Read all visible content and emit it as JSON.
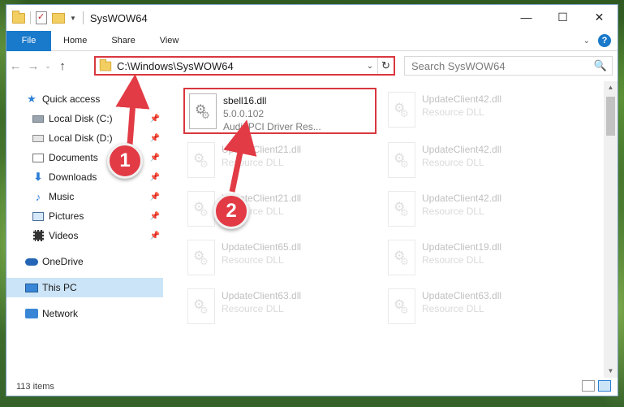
{
  "window": {
    "title": "SysWOW64"
  },
  "winctl": {
    "minimize": "—",
    "maximize": "☐",
    "close": "✕"
  },
  "ribbon": {
    "tabs": [
      "File",
      "Home",
      "Share",
      "View"
    ],
    "help": "?"
  },
  "address": {
    "path": "C:\\Windows\\SysWOW64",
    "refresh": "↻"
  },
  "search": {
    "placeholder": "Search SysWOW64",
    "icon": "🔍"
  },
  "sidebar": {
    "items": [
      {
        "label": "Quick access",
        "icon": "star-icon",
        "pinned": false
      },
      {
        "label": "Local Disk (C:)",
        "icon": "disk-icon",
        "pinned": true
      },
      {
        "label": "Local Disk (D:)",
        "icon": "disk-icon",
        "pinned": true
      },
      {
        "label": "Documents",
        "icon": "documents-icon",
        "pinned": true
      },
      {
        "label": "Downloads",
        "icon": "download-icon",
        "pinned": true
      },
      {
        "label": "Music",
        "icon": "music-icon",
        "pinned": true
      },
      {
        "label": "Pictures",
        "icon": "pictures-icon",
        "pinned": true
      },
      {
        "label": "Videos",
        "icon": "video-icon",
        "pinned": true
      },
      {
        "label": "OneDrive",
        "icon": "cloud-icon",
        "pinned": false
      },
      {
        "label": "This PC",
        "icon": "pc-icon",
        "pinned": false,
        "selected": true
      },
      {
        "label": "Network",
        "icon": "network-icon",
        "pinned": false
      }
    ]
  },
  "files": [
    {
      "name": "sbell16.dll",
      "version": "5.0.0.102",
      "desc": "AudioPCI Driver Res...",
      "highlighted": true
    },
    {
      "name": "UpdateClient42.dll",
      "desc": "Resource DLL"
    },
    {
      "name": "UpdateClient21.dll",
      "desc": "Resource DLL"
    },
    {
      "name": "UpdateClient42.dll",
      "desc": "Resource DLL"
    },
    {
      "name": "UpdateClient21.dll",
      "desc": "Resource DLL"
    },
    {
      "name": "UpdateClient42.dll",
      "desc": "Resource DLL"
    },
    {
      "name": "UpdateClient65.dll",
      "desc": "Resource DLL"
    },
    {
      "name": "UpdateClient19.dll",
      "desc": "Resource DLL"
    },
    {
      "name": "UpdateClient63.dll",
      "desc": "Resource DLL"
    },
    {
      "name": "UpdateClient63.dll",
      "desc": "Resource DLL"
    }
  ],
  "status": {
    "count": "113 items"
  },
  "annotations": [
    "1",
    "2"
  ],
  "colors": {
    "accent": "#1979ca",
    "highlight": "#d9373f",
    "marker": "#e23b45",
    "selected": "#cce4f7"
  }
}
